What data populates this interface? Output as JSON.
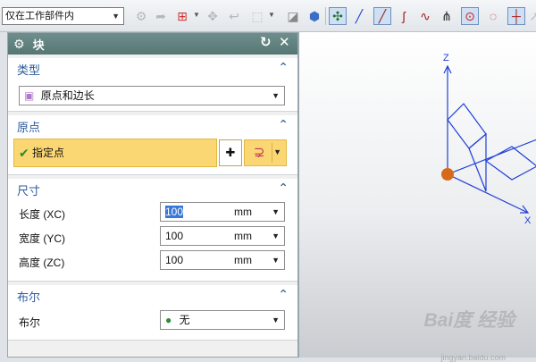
{
  "toolbar": {
    "selection_filter": "仅在工作部件内",
    "icons": [
      "component-icon",
      "arrow-icon",
      "snap-icon",
      "point-icon",
      "arc-point-icon",
      "selection-box-icon",
      "cube-solid-icon",
      "cube-face-icon",
      "snap-endpoint-icon",
      "line-icon",
      "diagonal-line-icon",
      "curve-icon",
      "spline-icon",
      "intersect-icon",
      "circle-center-icon",
      "circle-quadrant-icon",
      "cross-icon",
      "partial-icon"
    ]
  },
  "dialog": {
    "title": "块",
    "type_group": {
      "header": "类型",
      "selected": "原点和边长"
    },
    "origin_group": {
      "header": "原点",
      "specify_point": "指定点"
    },
    "size_group": {
      "header": "尺寸",
      "rows": [
        {
          "label": "长度 (XC)",
          "value": "100",
          "unit": "mm"
        },
        {
          "label": "宽度 (YC)",
          "value": "100",
          "unit": "mm"
        },
        {
          "label": "高度 (ZC)",
          "value": "100",
          "unit": "mm"
        }
      ]
    },
    "boolean_group": {
      "header": "布尔",
      "label": "布尔",
      "selected": "无"
    }
  },
  "viewport": {
    "axis_x": "X",
    "axis_z": "Z",
    "watermark_logo": "Bai度 经验",
    "watermark_url": "jingyan.baidu.com"
  },
  "colors": {
    "dialog_title_bg": "#557774",
    "group_header": "#2b5b9e",
    "highlight": "#fbd773",
    "axis": "#1f3fd6",
    "origin_point": "#d76a1a"
  }
}
